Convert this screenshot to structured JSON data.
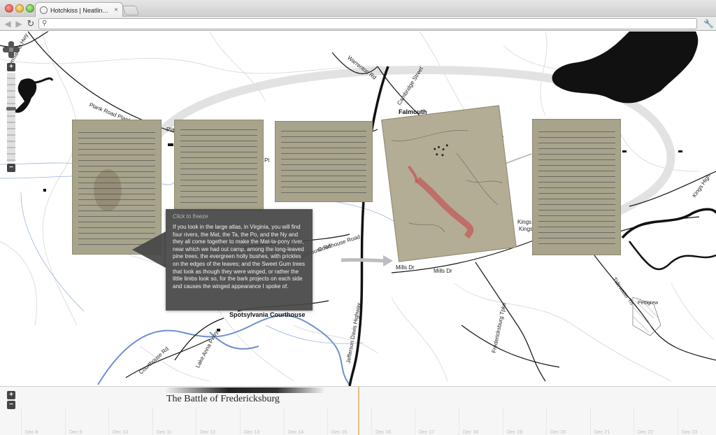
{
  "browser": {
    "tab_title": "Hotchkiss | Neatline:My Dea",
    "tab_close": "×",
    "url": "",
    "back_glyph": "◀",
    "forward_glyph": "▶",
    "reload_glyph": "↻",
    "wrench_glyph": "🔧",
    "search_glyph": "⚲"
  },
  "map": {
    "labels": [
      {
        "text": "Germanna Hwy",
        "bold": false
      },
      {
        "text": "Plank Road Plank R",
        "bold": false
      },
      {
        "text": "Warrenton Rd",
        "bold": false
      },
      {
        "text": "Cambridge Street",
        "bold": false
      },
      {
        "text": "Falmouth",
        "bold": true
      },
      {
        "text": "Courthouse Road",
        "bold": false
      },
      {
        "text": "Courthouse Rd",
        "bold": false
      },
      {
        "text": "Mills Dr",
        "bold": false
      },
      {
        "text": "Mills Dr",
        "bold": false
      },
      {
        "text": "Spotsylvania Courthouse",
        "bold": true
      },
      {
        "text": "Jefferson Davis Highway",
        "bold": false
      },
      {
        "text": "Lake Anna Pkwy",
        "bold": false
      },
      {
        "text": "Courthouse Rd",
        "bold": false
      },
      {
        "text": "Fredericksburg Tpke",
        "bold": false
      },
      {
        "text": "Tidewater Trl",
        "bold": false
      },
      {
        "text": "Pettigrew",
        "bold": false
      },
      {
        "text": "Kings",
        "bold": false
      },
      {
        "text": "Kings",
        "bold": false
      },
      {
        "text": "Kings High",
        "bold": false
      },
      {
        "text": "Pla",
        "bold": false
      },
      {
        "text": "Pl",
        "bold": false
      }
    ],
    "zoom_in": "+",
    "zoom_out": "−"
  },
  "popup": {
    "hint": "Click to freeze",
    "text": "If you look in the large atlas, in Virginia, you will find four rivers, the Mat, the Ta, the Po, and the Ny and they all come together to make the Mat-ta-pony river, near which we had out camp, among the long-leaved pine trees, the evergreen holly bushes, with prickles on the edges of the leaves; and the Sweet Gum trees that look as though they were winged, or rather the little limbs look so, for the bark projects on each side and causes the winged appearance I spoke of."
  },
  "timeline": {
    "title": "The Battle of Fredericksburg",
    "zoom_in": "+",
    "zoom_out": "−",
    "ticks": [
      "Dec 8",
      "Dec 9",
      "Dec 10",
      "Dec 11",
      "Dec 12",
      "Dec 13",
      "Dec 14",
      "Dec 15",
      "Dec 16",
      "Dec 17",
      "Dec 18",
      "Dec 19",
      "Dec 20",
      "Dec 21",
      "Dec 22",
      "Dec 23"
    ]
  },
  "colors": {
    "river": "#6f8fd0",
    "road": "#111111",
    "popup_bg": "#464646",
    "timeline_marker": "#e1c27a"
  }
}
